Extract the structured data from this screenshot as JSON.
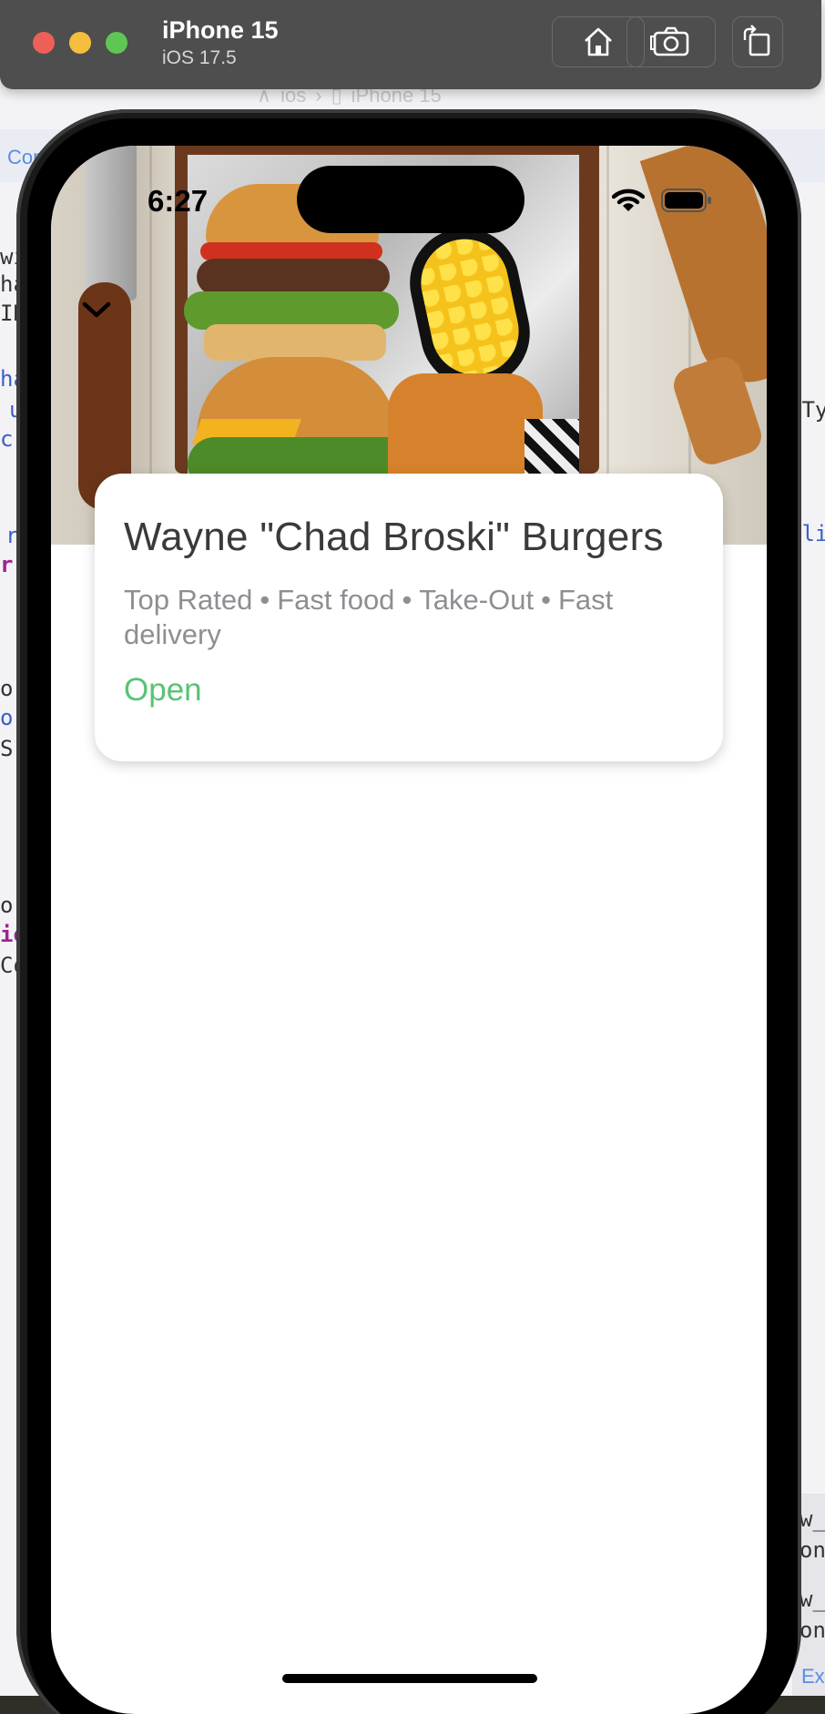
{
  "simulator": {
    "device_name": "iPhone 15",
    "os_version": "iOS 17.5",
    "toolbar_icons": [
      "home-icon",
      "screenshot-icon",
      "rotate-icon"
    ]
  },
  "background": {
    "breadcrumb": [
      "ios",
      "iPhone 15"
    ],
    "tab_fragment": "Cont",
    "code_fragments": [
      "wi",
      "ha",
      "IK",
      "ha",
      "u",
      "c",
      "r",
      "r",
      "or",
      "o",
      "S",
      "or",
      "io",
      "Co",
      ":Ty",
      "oli",
      "w_",
      "on",
      "w_",
      "on"
    ],
    "bottom_button_fragment": "Ex"
  },
  "status_bar": {
    "time": "6:27"
  },
  "restaurant": {
    "name": "Wayne \"Chad Broski\" Burgers",
    "tags": [
      "Top Rated",
      "Fast food",
      "Take-Out",
      "Fast delivery"
    ],
    "separator": "•",
    "status": "Open"
  },
  "colors": {
    "open_status": "#58c474",
    "title_text": "#3a3a3c",
    "tag_text": "#8e8e93",
    "simulator_bar": "#4e4e4e"
  }
}
